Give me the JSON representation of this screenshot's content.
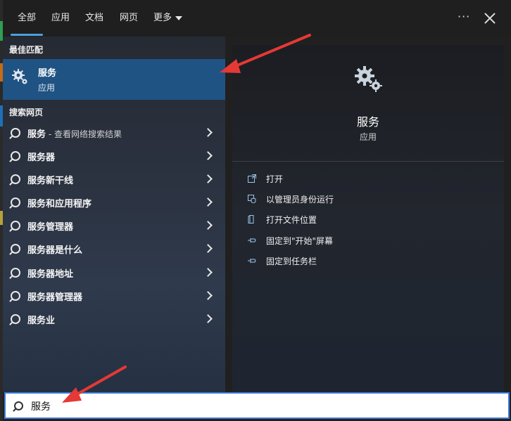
{
  "tabs": [
    {
      "label": "全部"
    },
    {
      "label": "应用"
    },
    {
      "label": "文档"
    },
    {
      "label": "网页"
    },
    {
      "label": "更多"
    }
  ],
  "header": {
    "more_icon": "ellipsis-icon",
    "close_icon": "close-icon"
  },
  "best_match": {
    "section_title": "最佳匹配",
    "title": "服务",
    "subtitle": "应用"
  },
  "web": {
    "section_title": "搜索网页",
    "items": [
      {
        "text": "服务",
        "suffix": " - 查看网络搜索结果"
      },
      {
        "text": "服务器",
        "suffix": ""
      },
      {
        "text": "服务新干线",
        "suffix": ""
      },
      {
        "text": "服务和应用程序",
        "suffix": ""
      },
      {
        "text": "服务管理器",
        "suffix": ""
      },
      {
        "text": "服务器是什么",
        "suffix": ""
      },
      {
        "text": "服务器地址",
        "suffix": ""
      },
      {
        "text": "服务器管理器",
        "suffix": ""
      },
      {
        "text": "服务业",
        "suffix": ""
      }
    ]
  },
  "detail": {
    "title": "服务",
    "subtitle": "应用",
    "actions": [
      {
        "label": "打开",
        "icon": "open-icon"
      },
      {
        "label": "以管理员身份运行",
        "icon": "shield-icon"
      },
      {
        "label": "打开文件位置",
        "icon": "folder-icon"
      },
      {
        "label": "固定到\"开始\"屏幕",
        "icon": "pin-icon"
      },
      {
        "label": "固定到任务栏",
        "icon": "pin-icon"
      }
    ]
  },
  "search": {
    "value": "服务"
  },
  "colors": {
    "accent": "#4ca0e0",
    "highlight": "#1f5383",
    "arrow": "#e53935"
  }
}
